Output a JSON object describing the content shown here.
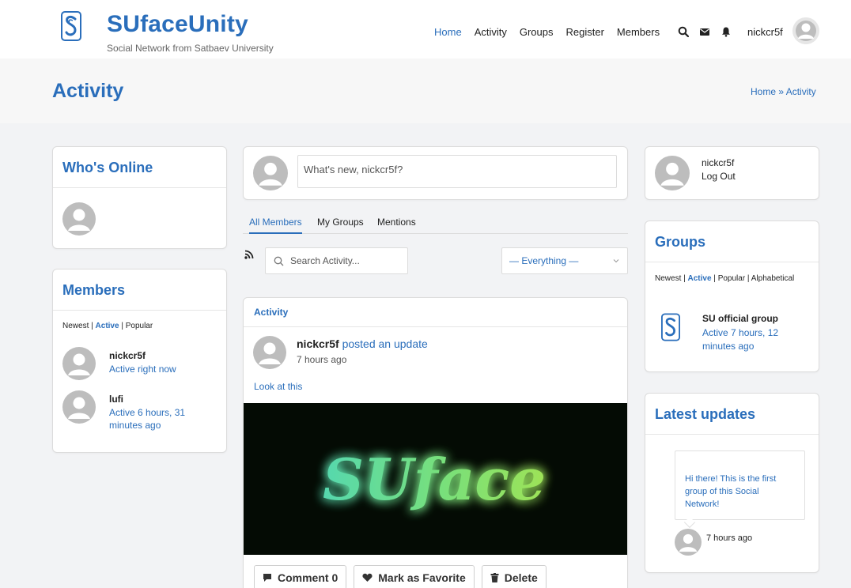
{
  "site": {
    "title": "SUfaceUnity",
    "subtitle": "Social Network from Satbaev University"
  },
  "nav": {
    "items": [
      "Home",
      "Activity",
      "Groups",
      "Register",
      "Members"
    ],
    "active": "Home",
    "username": "nickcr5f"
  },
  "page": {
    "title": "Activity",
    "breadcrumb": "Home » Activity"
  },
  "whos_online": {
    "title": "Who's Online"
  },
  "members": {
    "title": "Members",
    "filters": {
      "newest": "Newest",
      "active": "Active",
      "popular": "Popular",
      "sep": "|"
    },
    "list": [
      {
        "name": "nickcr5f",
        "status": "Active right now"
      },
      {
        "name": "lufi",
        "status": "Active 6 hours, 31 minutes ago"
      }
    ]
  },
  "post_box": {
    "placeholder": "What's new, nickcr5f?"
  },
  "tabs": [
    "All Members",
    "My Groups",
    "Mentions"
  ],
  "search": {
    "placeholder": "Search Activity..."
  },
  "filter": {
    "value": "— Everything —"
  },
  "activity_item": {
    "header": "Activity",
    "author": "nickcr5f",
    "action": "posted an update",
    "time": "7 hours ago",
    "text": "Look at this",
    "image_text": "SUface",
    "buttons": {
      "comment": "Comment",
      "comment_count": "0",
      "favorite": "Mark as Favorite",
      "delete": "Delete"
    }
  },
  "me": {
    "name": "nickcr5f",
    "logout": "Log Out"
  },
  "groups": {
    "title": "Groups",
    "filters": {
      "newest": "Newest",
      "active": "Active",
      "popular": "Popular",
      "alphabetical": "Alphabetical"
    },
    "item": {
      "name": "SU official group",
      "status": "Active 7 hours, 12 minutes ago"
    }
  },
  "latest": {
    "title": "Latest updates",
    "message": "Hi there! This is the first group of this Social Network!",
    "time": "7 hours ago"
  },
  "colors": {
    "accent": "#2a6ebb",
    "background": "#f2f3f5",
    "card": "#ffffff"
  }
}
